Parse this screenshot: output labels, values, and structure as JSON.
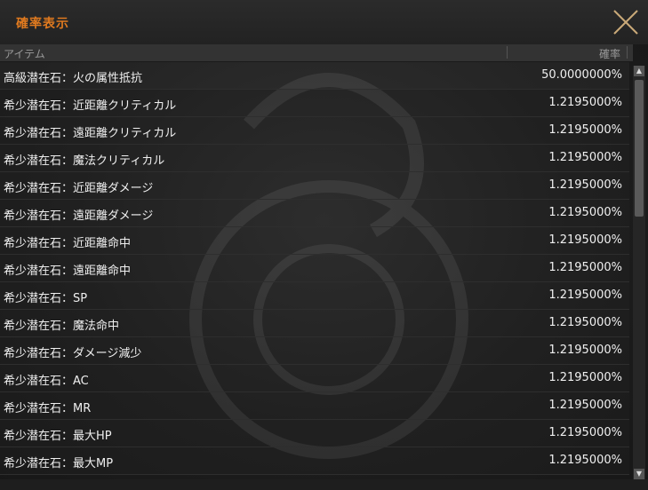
{
  "window": {
    "title": "確率表示"
  },
  "header": {
    "item_label": "アイテム",
    "rate_label": "確率"
  },
  "rows": [
    {
      "name": "高級潜在石：火の属性抵抗",
      "rate": "50.0000000%"
    },
    {
      "name": "希少潜在石：近距離クリティカル",
      "rate": "1.2195000%"
    },
    {
      "name": "希少潜在石：遠距離クリティカル",
      "rate": "1.2195000%"
    },
    {
      "name": "希少潜在石：魔法クリティカル",
      "rate": "1.2195000%"
    },
    {
      "name": "希少潜在石：近距離ダメージ",
      "rate": "1.2195000%"
    },
    {
      "name": "希少潜在石：遠距離ダメージ",
      "rate": "1.2195000%"
    },
    {
      "name": "希少潜在石：近距離命中",
      "rate": "1.2195000%"
    },
    {
      "name": "希少潜在石：遠距離命中",
      "rate": "1.2195000%"
    },
    {
      "name": "希少潜在石：SP",
      "rate": "1.2195000%"
    },
    {
      "name": "希少潜在石：魔法命中",
      "rate": "1.2195000%"
    },
    {
      "name": "希少潜在石：ダメージ減少",
      "rate": "1.2195000%"
    },
    {
      "name": "希少潜在石：AC",
      "rate": "1.2195000%"
    },
    {
      "name": "希少潜在石：MR",
      "rate": "1.2195000%"
    },
    {
      "name": "希少潜在石：最大HP",
      "rate": "1.2195000%"
    },
    {
      "name": "希少潜在石：最大MP",
      "rate": "1.2195000%"
    }
  ],
  "colors": {
    "title_accent": "#e07a1f",
    "close_icon": "#c9a978"
  },
  "icons": {
    "close": "close-icon",
    "scroll_up": "scroll-up-icon",
    "scroll_down": "scroll-down-icon"
  }
}
